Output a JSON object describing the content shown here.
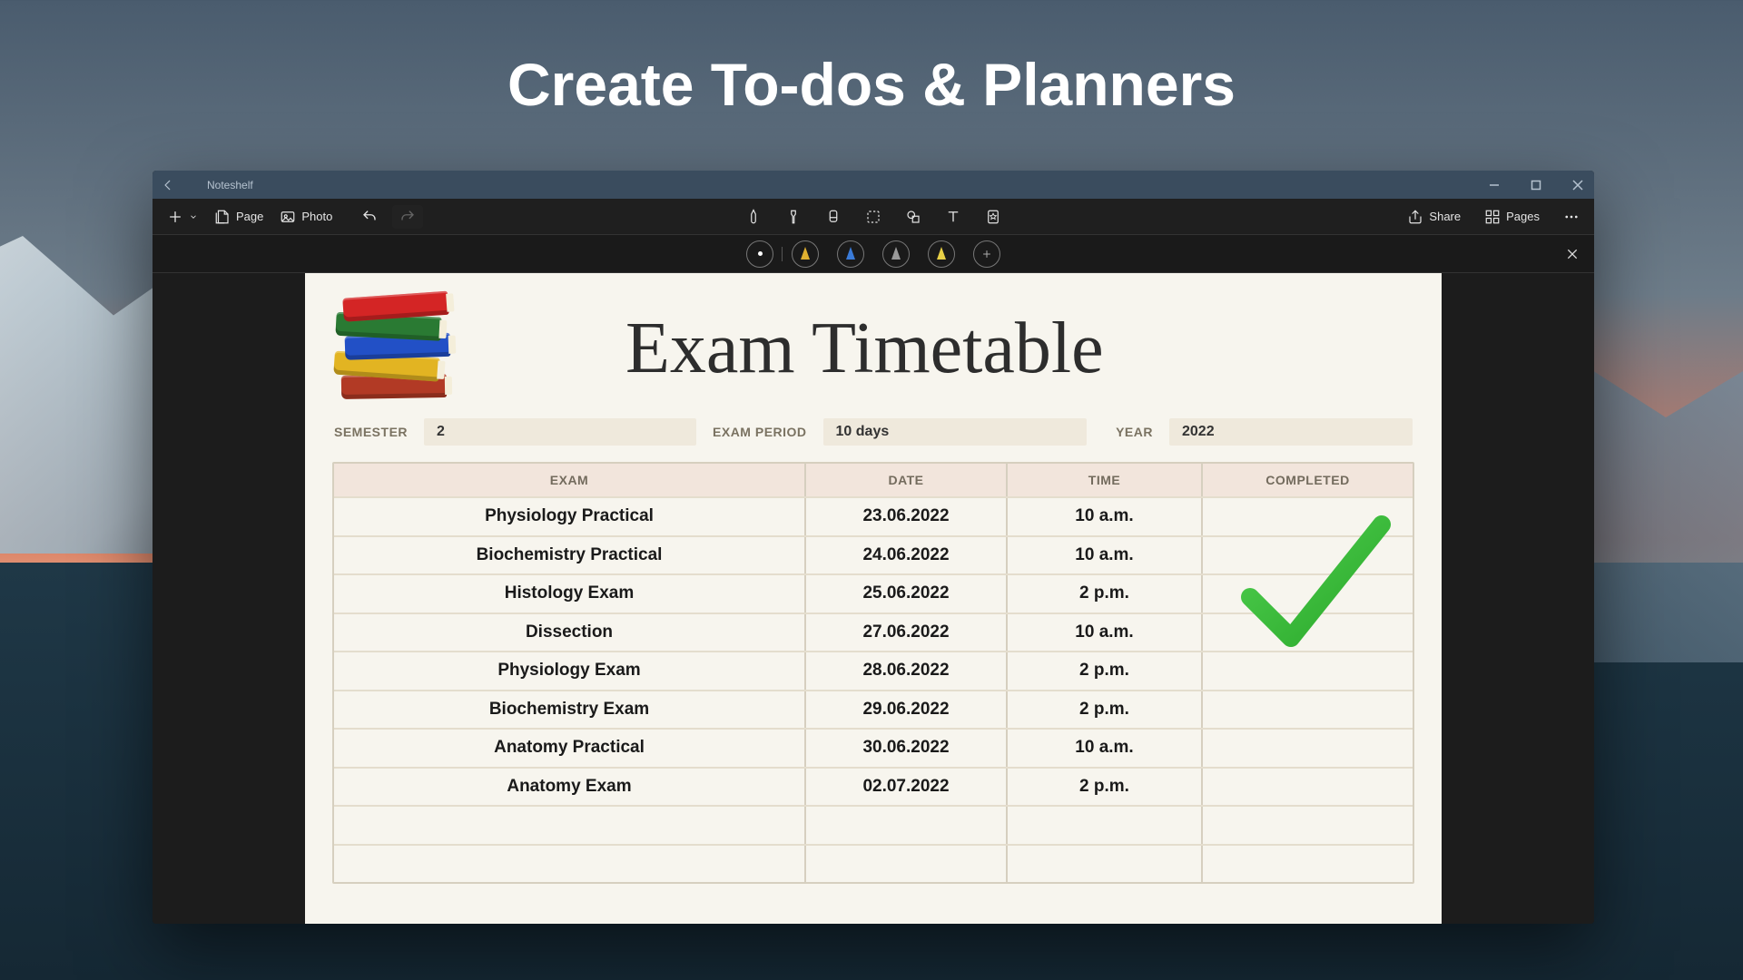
{
  "headline": "Create To-dos & Planners",
  "titlebar": {
    "app_name": "Noteshelf"
  },
  "toolbar": {
    "page_label": "Page",
    "photo_label": "Photo",
    "share_label": "Share",
    "pages_label": "Pages"
  },
  "pens": {
    "colors": [
      "#ffffff",
      "#e0b030",
      "#3a7bd8",
      "#9a9a9a",
      "#e8d046"
    ]
  },
  "doc": {
    "title": "Exam Timetable",
    "meta": {
      "semester_label": "SEMESTER",
      "semester_value": "2",
      "period_label": "EXAM PERIOD",
      "period_value": "10 days",
      "year_label": "YEAR",
      "year_value": "2022"
    },
    "columns": {
      "exam": "EXAM",
      "date": "DATE",
      "time": "TIME",
      "completed": "COMPLETED"
    },
    "rows": [
      {
        "exam": "Physiology Practical",
        "date": "23.06.2022",
        "time": "10 a.m."
      },
      {
        "exam": "Biochemistry Practical",
        "date": "24.06.2022",
        "time": "10 a.m."
      },
      {
        "exam": "Histology Exam",
        "date": "25.06.2022",
        "time": "2 p.m."
      },
      {
        "exam": "Dissection",
        "date": "27.06.2022",
        "time": "10 a.m."
      },
      {
        "exam": "Physiology Exam",
        "date": "28.06.2022",
        "time": "2 p.m."
      },
      {
        "exam": "Biochemistry Exam",
        "date": "29.06.2022",
        "time": "2 p.m."
      },
      {
        "exam": "Anatomy Practical",
        "date": "30.06.2022",
        "time": "10 a.m."
      },
      {
        "exam": "Anatomy Exam",
        "date": "02.07.2022",
        "time": "2 p.m."
      }
    ],
    "check_color": "#2aa82a"
  }
}
